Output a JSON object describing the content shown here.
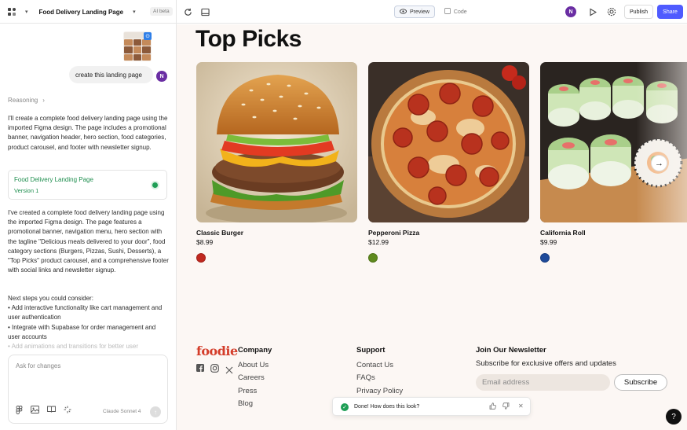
{
  "topbar": {
    "project_title": "Food Delivery Landing Page",
    "beta_badge": "AI beta",
    "preview_label": "Preview",
    "code_label": "Code",
    "user_initial": "N",
    "publish_label": "Publish",
    "share_label": "Share"
  },
  "chat": {
    "user_message": "create this landing page",
    "user_initial": "N",
    "reasoning_label": "Reasoning",
    "intro": "I'll create a complete food delivery landing page using the imported Figma design. The page includes a promotional banner, navigation header, hero section, food categories, product carousel, and footer with newsletter signup.",
    "artifact_title": "Food Delivery Landing Page",
    "artifact_version": "Version 1",
    "summary": "I've created a complete food delivery landing page using the imported Figma design. The page features a promotional banner, navigation menu, hero section with the tagline \"Delicious meals delivered to your door\", food category sections (Burgers, Pizzas, Sushi, Desserts), a \"Top Picks\" product carousel, and a comprehensive footer with social links and newsletter signup.",
    "next_steps_title": "Next steps you could consider:",
    "next_steps": [
      "• Add interactive functionality like cart management and user authentication",
      "• Integrate with Supabase for order management and user accounts",
      "• Add animations and transitions for better user"
    ],
    "input_placeholder": "Ask for changes",
    "model_label": "Claude Sonnet 4"
  },
  "preview": {
    "section_title": "Top Picks",
    "products": [
      {
        "name": "Classic Burger",
        "price": "$8.99",
        "swatch": "#c0281f"
      },
      {
        "name": "Pepperoni Pizza",
        "price": "$12.99",
        "swatch": "#5f8a1e"
      },
      {
        "name": "California Roll",
        "price": "$9.99",
        "swatch": "#1e4a9a"
      }
    ],
    "footer": {
      "brand": "foodie",
      "company_heading": "Company",
      "company_links": [
        "About Us",
        "Careers",
        "Press",
        "Blog"
      ],
      "support_heading": "Support",
      "support_links": [
        "Contact Us",
        "FAQs",
        "Privacy Policy"
      ],
      "newsletter_heading": "Join Our Newsletter",
      "newsletter_sub": "Subscribe for exclusive offers and updates",
      "email_placeholder": "Email address",
      "subscribe_label": "Subscribe"
    }
  },
  "toast": {
    "message": "Done! How does this look?"
  },
  "help_label": "?"
}
